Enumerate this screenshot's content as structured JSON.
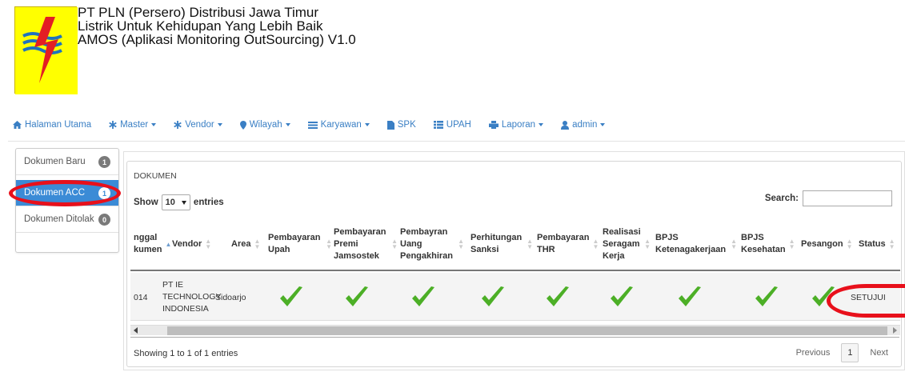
{
  "header": {
    "lines": [
      "PT PLN (Persero) Distribusi Jawa Timur",
      "Listrik Untuk Kehidupan Yang Lebih Baik",
      "AMOS (Aplikasi Monitoring OutSourcing) V1.0"
    ]
  },
  "nav": {
    "items": [
      {
        "label": "Halaman Utama",
        "icon": "home-icon",
        "dropdown": false
      },
      {
        "label": "Master",
        "icon": "asterisk-icon",
        "dropdown": true
      },
      {
        "label": "Vendor",
        "icon": "asterisk-icon",
        "dropdown": true
      },
      {
        "label": "Wilayah",
        "icon": "map-marker-icon",
        "dropdown": true
      },
      {
        "label": "Karyawan",
        "icon": "tasks-icon",
        "dropdown": true
      },
      {
        "label": "SPK",
        "icon": "file-icon",
        "dropdown": false
      },
      {
        "label": "UPAH",
        "icon": "list-icon",
        "dropdown": false
      },
      {
        "label": "Laporan",
        "icon": "print-icon",
        "dropdown": true
      },
      {
        "label": "admin",
        "icon": "user-icon",
        "dropdown": true
      }
    ],
    "accent": "#3a7fc4"
  },
  "sidebar": {
    "items": [
      {
        "label": "Dokumen Baru",
        "count": "1",
        "active": false
      },
      {
        "label": "Dokumen ACC",
        "count": "1",
        "active": true
      },
      {
        "label": "Dokumen Ditolak",
        "count": "0",
        "active": false
      }
    ],
    "active_color": "#3b8bd6"
  },
  "panel": {
    "heading": "DOKUMEN",
    "show_label": "Show",
    "entries_value": "10",
    "entries_label": "entries",
    "search_label": "Search:",
    "search_value": ""
  },
  "table": {
    "columns": [
      "nggal kumen",
      "Vendor",
      "Area",
      "Pembayaran Upah",
      "Pembayaran Premi Jamsostek",
      "Pembayran Uang Pengakhiran",
      "Perhitungan Sanksi",
      "Pembayaran THR",
      "Realisasi Seragam Kerja",
      "BPJS Ketenagakerjaan",
      "BPJS Kesehatan",
      "Pesangon",
      "Status"
    ],
    "rows": [
      {
        "tanggal": "014",
        "vendor": "PT IE TECHNOLOGY INDONESIA",
        "area": "Sidoarjo",
        "checks": [
          "check-icon",
          "check-icon",
          "check-icon",
          "check-icon",
          "check-icon",
          "check-icon",
          "check-icon",
          "check-icon",
          "check-icon"
        ],
        "status": "SETUJUI"
      }
    ],
    "check_color": "#4caf26"
  },
  "footer": {
    "showing": "Showing 1 to 1 of 1 entries",
    "previous": "Previous",
    "page": "1",
    "next": "Next"
  },
  "highlight_color": "#e8101b"
}
